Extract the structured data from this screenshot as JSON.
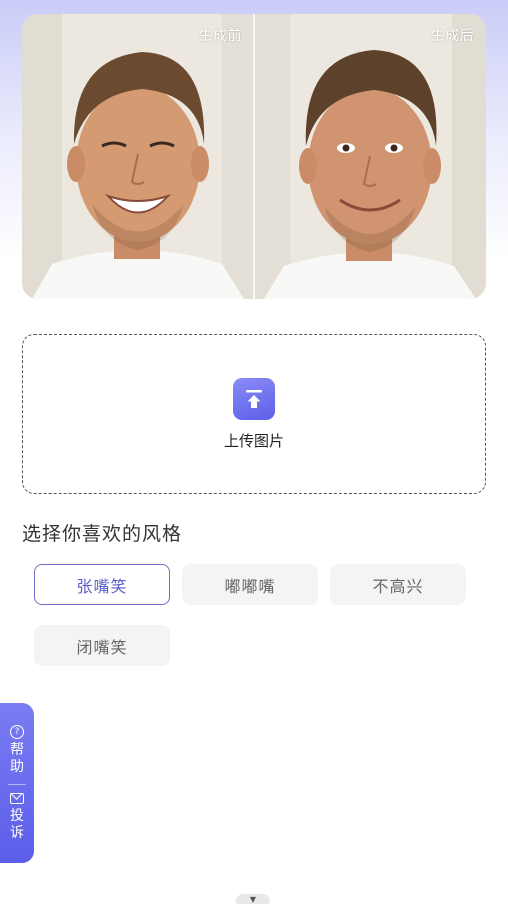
{
  "preview": {
    "before_label": "生成前",
    "after_label": "生成后"
  },
  "upload": {
    "label": "上传图片",
    "icon": "upload-arrow-icon"
  },
  "section_title": "选择你喜欢的风格",
  "styles": [
    {
      "label": "张嘴笑",
      "selected": true
    },
    {
      "label": "嘟嘟嘴",
      "selected": false
    },
    {
      "label": "不高兴",
      "selected": false
    },
    {
      "label": "闭嘴笑",
      "selected": false
    }
  ],
  "side_tab": {
    "help_label_1": "帮",
    "help_label_2": "助",
    "complaint_label_1": "投",
    "complaint_label_2": "诉"
  },
  "colors": {
    "accent": "#5b5ee8",
    "selected_border": "#6b6ec4"
  }
}
